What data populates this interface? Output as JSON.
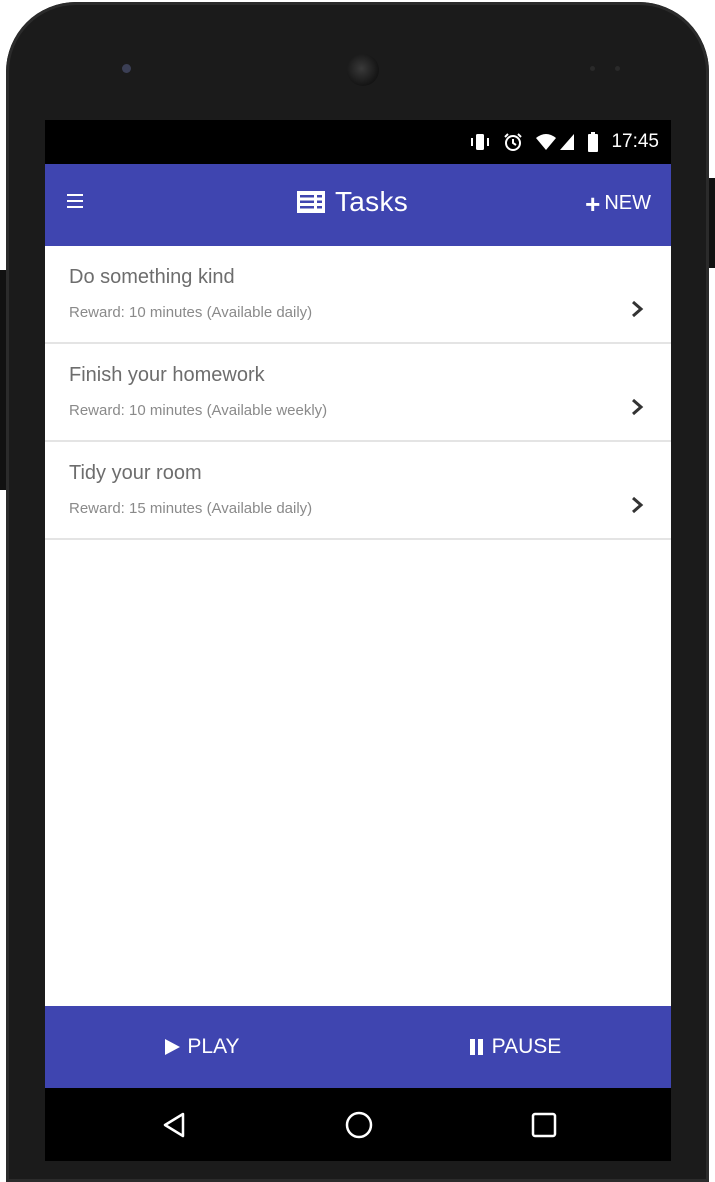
{
  "statusbar": {
    "time": "17:45",
    "icons": [
      "vibrate-icon",
      "alarm-icon",
      "wifi-icon",
      "signal-icon",
      "battery-icon"
    ]
  },
  "appbar": {
    "menu_icon": "hamburger-menu-icon",
    "title_icon": "task-list-icon",
    "title": "Tasks",
    "new_label": "NEW"
  },
  "tasks": [
    {
      "title": "Do something kind",
      "subtitle": "Reward: 10 minutes (Available daily)"
    },
    {
      "title": "Finish your homework",
      "subtitle": "Reward: 10 minutes (Available weekly)"
    },
    {
      "title": "Tidy your room",
      "subtitle": "Reward: 15 minutes (Available daily)"
    }
  ],
  "bottombar": {
    "play_label": "PLAY",
    "pause_label": "PAUSE"
  },
  "navbar": {
    "icons": [
      "back-icon",
      "home-icon",
      "recents-icon"
    ]
  },
  "colors": {
    "accent": "#3f45b0",
    "status_bg": "#000000",
    "divider": "#e4e4e4"
  }
}
